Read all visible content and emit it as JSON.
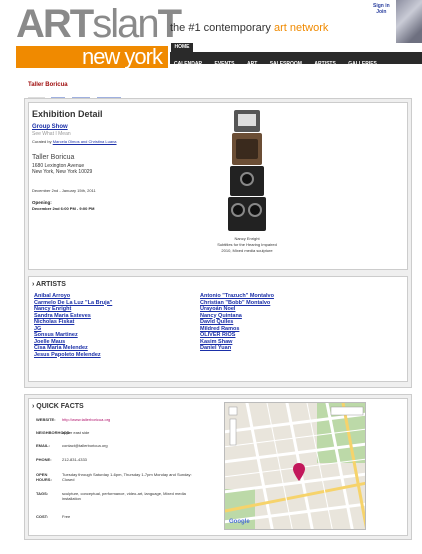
{
  "header": {
    "logo_part1": "ART",
    "logo_part2": "slan",
    "logo_part3": "T",
    "city": "new york",
    "tagline_before": "the #1 contemporary ",
    "tagline_accent": "art network",
    "top_links": [
      "Sign in",
      "Join"
    ],
    "nav": [
      "CALENDAR",
      "EVENTS",
      "ART",
      "SALESROOM",
      "ARTISTS",
      "GALLERIES"
    ],
    "home": "HOME"
  },
  "venue_name": "Taller Boricua",
  "tabs": [
    "Event",
    "Map",
    "Artists",
    "Comment"
  ],
  "detail": {
    "heading": "Exhibition Detail",
    "show_type": "Group Show",
    "show_title": "See What I Mean",
    "curated_prefix": "Curated by",
    "curator": "Marcela Olmos and Christina Luana",
    "venue": "Taller Boricua",
    "address1": "1680 Lexington Avenue",
    "address2": "New York, New York 10029",
    "dates": "December 2nd - January 15th, 2011",
    "opening_label": "Opening:",
    "opening": "December 2nd 6:00 PM - 9:00 PM",
    "caption_artist": "Nancy Enright",
    "caption_title": "Subtitles for the Hearing Impaired",
    "caption_info": "2010, Mixed media sculpture"
  },
  "artists": {
    "heading": "ARTISTS",
    "left": [
      "Anibal Arroyo",
      "Carmelo De La Luz \"La Bruja\"",
      "Nancy Enright",
      "Sandra Maria Esteves",
      "Nicholas Fiskat",
      "JG",
      "Sonsus Martinez",
      "Joelle Maus",
      "Cisa Maria Melendez",
      "Jesus Papoleto Melendez"
    ],
    "right": [
      "Antonio \"Trazuch\" Montalvo",
      "Christian \"Bobb\" Montalvo",
      "Urayoán Noel",
      "Nancy Quintana",
      "David Quiles",
      "Mildred Ramos",
      "OLIVER RIOS",
      "Kasim Shaw",
      "Daniel Yuan"
    ]
  },
  "quickfacts": {
    "heading": "QUICK FACTS",
    "rows": [
      {
        "label": "WEBSITE:",
        "value": "http://www.tallerboricua.org"
      },
      {
        "label": "NEIGHBORHOOD:",
        "value": "upper east side"
      },
      {
        "label": "EMAIL:",
        "value": "contact@tallerboricua.org"
      },
      {
        "label": "PHONE:",
        "value": "212-831-4333"
      },
      {
        "label": "OPEN HOURS:",
        "value": "Tuesday through Saturday 1-6pm, Thursday 1-7pm Monday and Sunday: Closed"
      },
      {
        "label": "TAGS:",
        "value": "sculpture, conceptual, performance, video-art, language, Mixed media installation"
      },
      {
        "label": "COST:",
        "value": "Free"
      }
    ]
  },
  "map": {
    "brand": "Google",
    "marker_color": "#c2185b"
  },
  "colors": {
    "accent": "#f08a00",
    "link": "#1a2fa8",
    "venue": "#a01010"
  }
}
